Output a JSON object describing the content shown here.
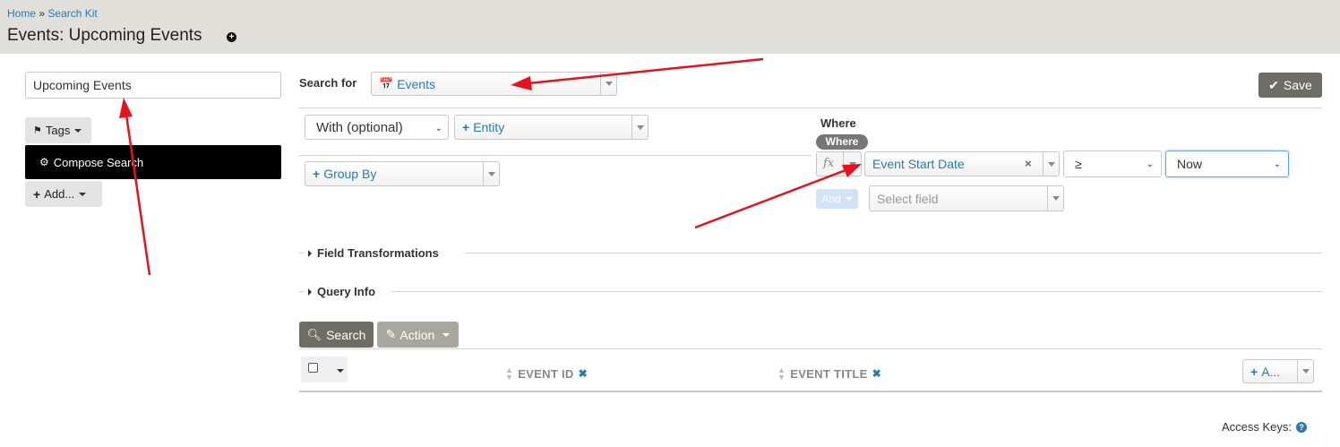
{
  "breadcrumb": {
    "home": "Home",
    "separator": "»",
    "current": "Search Kit"
  },
  "page": {
    "title": "Events: Upcoming Events"
  },
  "left": {
    "search_label_value": "Upcoming Events",
    "tags_label": "Tags",
    "compose_label": "Compose Search",
    "add_label": "Add..."
  },
  "search_for": {
    "label": "Search for",
    "entity": "Events",
    "entity_icon": "calendar-icon"
  },
  "toolbar": {
    "save_label": "Save"
  },
  "joins": {
    "join_type": "With (optional)",
    "entity_placeholder": "Entity",
    "group_by": "Group By"
  },
  "where": {
    "heading": "Where",
    "badge": "Where",
    "fx": "fx",
    "field": "Event Start Date",
    "clear": "×",
    "operator": "≥",
    "value": "Now",
    "and_label": "And",
    "select_field_placeholder": "Select field"
  },
  "sections": {
    "field_transformations": "Field Transformations",
    "query_info": "Query Info"
  },
  "results": {
    "search_label": "Search",
    "action_label": "Action",
    "columns": [
      {
        "label": "EVENT ID"
      },
      {
        "label": "EVENT TITLE"
      }
    ],
    "add_column_label": "A..."
  },
  "footer": {
    "access_keys": "Access Keys:"
  },
  "colors": {
    "accent": "#2a7ab0",
    "header_bg": "#e0dfd9",
    "primary_button": "#6d6d63",
    "annotation_arrow": "#e8101a"
  }
}
